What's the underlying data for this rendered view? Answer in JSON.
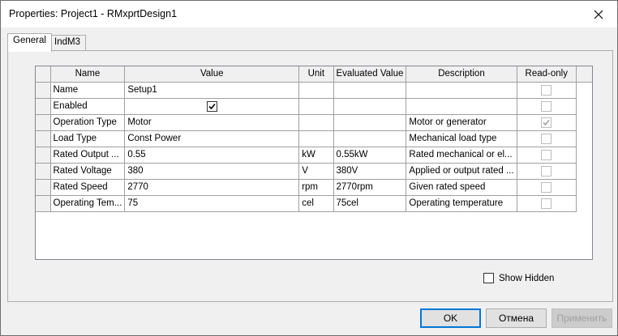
{
  "window": {
    "title": "Properties: Project1 - RMxprtDesign1",
    "close_icon": "close-icon"
  },
  "tabs": [
    {
      "label": "General",
      "active": true
    },
    {
      "label": "IndM3",
      "active": false
    }
  ],
  "table": {
    "columns": [
      "Name",
      "Value",
      "Unit",
      "Evaluated Value",
      "Description",
      "Read-only"
    ],
    "rows": [
      {
        "name": "Name",
        "value": "Setup1",
        "unit": "",
        "evaluated": "",
        "description": "",
        "read_only": false,
        "value_checkbox": false
      },
      {
        "name": "Enabled",
        "value": "",
        "unit": "",
        "evaluated": "",
        "description": "",
        "read_only": false,
        "value_checkbox": true,
        "value_checked": true
      },
      {
        "name": "Operation Type",
        "value": "Motor",
        "unit": "",
        "evaluated": "",
        "description": "Motor or generator",
        "read_only": true,
        "value_checkbox": false
      },
      {
        "name": "Load Type",
        "value": "Const Power",
        "unit": "",
        "evaluated": "",
        "description": "Mechanical load type",
        "read_only": false,
        "value_checkbox": false
      },
      {
        "name": "Rated Output ...",
        "value": "0.55",
        "unit": "kW",
        "evaluated": "0.55kW",
        "description": "Rated mechanical or el...",
        "read_only": false,
        "value_checkbox": false
      },
      {
        "name": "Rated Voltage",
        "value": "380",
        "unit": "V",
        "evaluated": "380V",
        "description": "Applied or output rated ...",
        "read_only": false,
        "value_checkbox": false
      },
      {
        "name": "Rated Speed",
        "value": "2770",
        "unit": "rpm",
        "evaluated": "2770rpm",
        "description": "Given rated speed",
        "read_only": false,
        "value_checkbox": false
      },
      {
        "name": "Operating Tem...",
        "value": "75",
        "unit": "cel",
        "evaluated": "75cel",
        "description": "Operating temperature",
        "read_only": false,
        "value_checkbox": false
      }
    ]
  },
  "show_hidden": {
    "label": "Show Hidden",
    "checked": false
  },
  "buttons": {
    "ok": "OK",
    "cancel": "Отмена",
    "apply": "Применить"
  }
}
